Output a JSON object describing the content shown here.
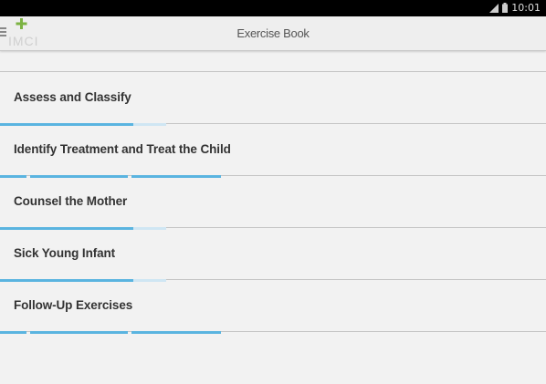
{
  "status_bar": {
    "time": "10:01",
    "icons": [
      "signal-icon",
      "battery-icon"
    ]
  },
  "app_bar": {
    "title": "Exercise Book",
    "logo_text": "IMCI",
    "drawer_icon": "drawer-menu-icon"
  },
  "colors": {
    "accent": "#5ab4e0",
    "accent_dim": "#cfe6f3",
    "logo_green": "#7cb342",
    "divider": "#c4c4c4"
  },
  "items": [
    {
      "label": "Assess and Classify",
      "progress": "partial"
    },
    {
      "label": "Identify Treatment and Treat the Child",
      "progress": "full"
    },
    {
      "label": "Counsel the Mother",
      "progress": "partial"
    },
    {
      "label": "Sick Young Infant",
      "progress": "partial"
    },
    {
      "label": "Follow-Up Exercises",
      "progress": "full"
    }
  ]
}
